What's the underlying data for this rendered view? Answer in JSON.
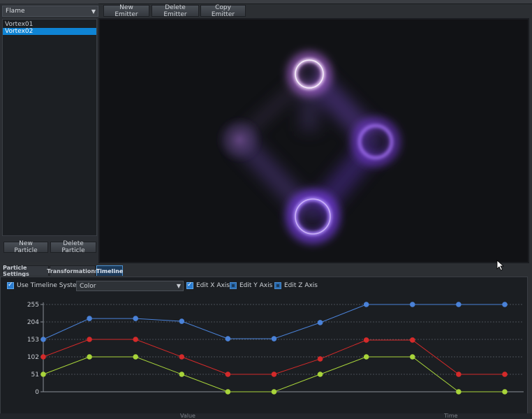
{
  "left": {
    "system_select": "Flame",
    "items": [
      {
        "label": "Vortex01",
        "selected": false
      },
      {
        "label": "Vortex02",
        "selected": true
      }
    ],
    "new_particle": "New Particle",
    "delete_particle": "Delete Particle"
  },
  "toolbar": {
    "new_emitter": "New Emitter",
    "delete_emitter": "Delete Emitter",
    "copy_emitter": "Copy Emitter"
  },
  "tabs": [
    {
      "label": "Particle Settings",
      "active": false
    },
    {
      "label": "Transformations",
      "active": false
    },
    {
      "label": "Timeline",
      "active": true
    }
  ],
  "timeline": {
    "use_timeline_label": "Use Timeline System",
    "use_timeline_checked": true,
    "property_select": "Color",
    "edit_x_label": "Edit X Axis",
    "edit_x_checked": true,
    "edit_y_label": "Edit Y Axis",
    "edit_y_checked": false,
    "edit_z_label": "Edit Z Axis",
    "edit_z_checked": false
  },
  "footer": {
    "value_label": "Value",
    "time_label": "Time"
  },
  "chart_data": {
    "type": "line",
    "y_ticks": [
      "255",
      "204",
      "153",
      "102",
      "51",
      "0"
    ],
    "ylim": [
      0,
      255
    ],
    "x": [
      0,
      1,
      2,
      3,
      4,
      5,
      6,
      7,
      8,
      9,
      10
    ],
    "grid": true,
    "series": [
      {
        "color": "#4a82d8",
        "values": [
          153,
          214,
          214,
          206,
          155,
          155,
          202,
          255,
          255,
          255,
          255
        ]
      },
      {
        "color": "#d42a2a",
        "values": [
          102,
          153,
          153,
          102,
          51,
          51,
          96,
          151,
          151,
          51,
          51
        ]
      },
      {
        "color": "#a8d43a",
        "values": [
          51,
          102,
          102,
          51,
          0,
          0,
          51,
          102,
          102,
          0,
          0
        ]
      }
    ]
  }
}
